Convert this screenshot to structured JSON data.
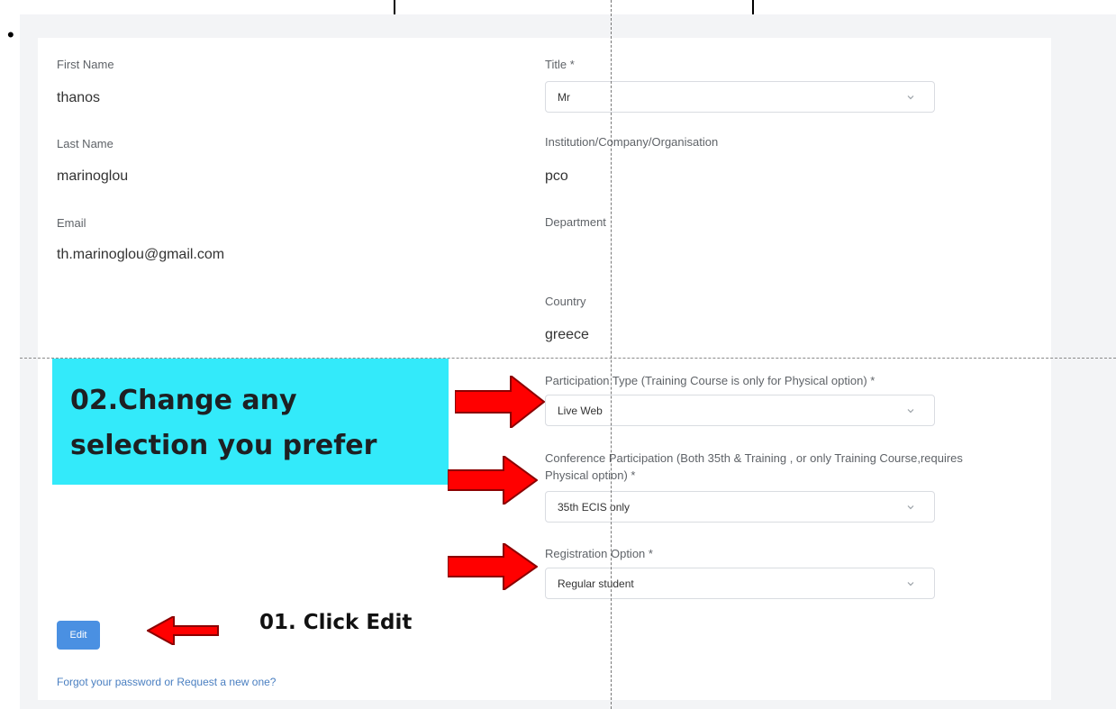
{
  "left_fields": [
    {
      "label": "First Name",
      "value": "thanos"
    },
    {
      "label": "Last Name",
      "value": "marinoglou"
    },
    {
      "label": "Email",
      "value": "th.marinoglou@gmail.com"
    }
  ],
  "right_fields": {
    "title_label": "Title *",
    "title_value": "Mr",
    "institution_label": "Institution/Company/Organisation",
    "institution_value": "pco",
    "department_label": "Department",
    "country_label": "Country",
    "country_value": "greece",
    "participation_type_label": "Participation Type (Training Course is only for Physical option) *",
    "participation_type_value": "Live Web",
    "conference_participation_label_line1": "Conference Participation (Both 35th & Training , or only Training Course,requires",
    "conference_participation_label_line2": "Physical option) *",
    "conference_participation_value": "35th ECIS only",
    "registration_option_label": "Registration Option *",
    "registration_option_value": "Regular student"
  },
  "actions": {
    "edit_label": "Edit",
    "forgot_link": "Forgot your password or Request a new one?"
  },
  "annotations": {
    "callout_line1": "02.Change any",
    "callout_line2": "selection you prefer",
    "edit_note": "01. Click Edit",
    "callout_color": "#33eafa",
    "arrow_color": "#ff0000"
  },
  "colors": {
    "edit_button": "#4a90e2",
    "link": "#4a7fc1"
  }
}
